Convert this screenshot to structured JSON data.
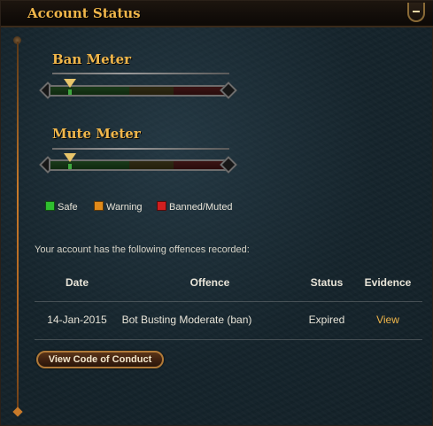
{
  "window": {
    "title": "Account Status",
    "collapse_icon": "minus-icon"
  },
  "ban_meter": {
    "title": "Ban Meter",
    "level": 0.12
  },
  "mute_meter": {
    "title": "Mute Meter",
    "level": 0.12
  },
  "legend": {
    "items": [
      {
        "label": "Safe",
        "color": "#2fbf2f"
      },
      {
        "label": "Warning",
        "color": "#e08a1a"
      },
      {
        "label": "Banned/Muted",
        "color": "#d11f1f"
      }
    ]
  },
  "offences": {
    "intro": "Your account has the following offences recorded:",
    "headers": {
      "date": "Date",
      "offence": "Offence",
      "status": "Status",
      "evidence": "Evidence"
    },
    "rows": [
      {
        "date": "14-Jan-2015",
        "offence": "Bot Busting Moderate (ban)",
        "status": "Expired",
        "evidence": "View"
      }
    ]
  },
  "actions": {
    "code_of_conduct": "View Code of Conduct"
  },
  "colors": {
    "accent": "#f0b64a",
    "link": "#f0b64a",
    "button_border": "#b07a38"
  }
}
